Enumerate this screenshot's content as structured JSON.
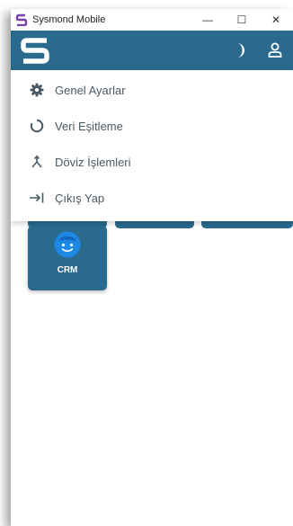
{
  "window": {
    "title": "Sysmond Mobile",
    "minimize_glyph": "—",
    "maximize_glyph": "☐",
    "close_glyph": "✕"
  },
  "appbar": {
    "logo_icon": "sysmond-s-logo",
    "theme_icon": "moon-icon",
    "account_icon": "user-icon",
    "color": "#2a6a8e"
  },
  "menu": {
    "items": [
      {
        "label": "Genel Ayarlar",
        "icon": "gear-icon"
      },
      {
        "label": "Veri Eşitleme",
        "icon": "sync-circle-icon"
      },
      {
        "label": "Döviz İşlemleri",
        "icon": "merge-arrow-icon"
      },
      {
        "label": "Çıkış Yap",
        "icon": "logout-icon"
      }
    ]
  },
  "tiles": [
    {
      "label": "CRM",
      "icon": "crm-face-icon",
      "icon_color": "#1e88e5"
    }
  ]
}
